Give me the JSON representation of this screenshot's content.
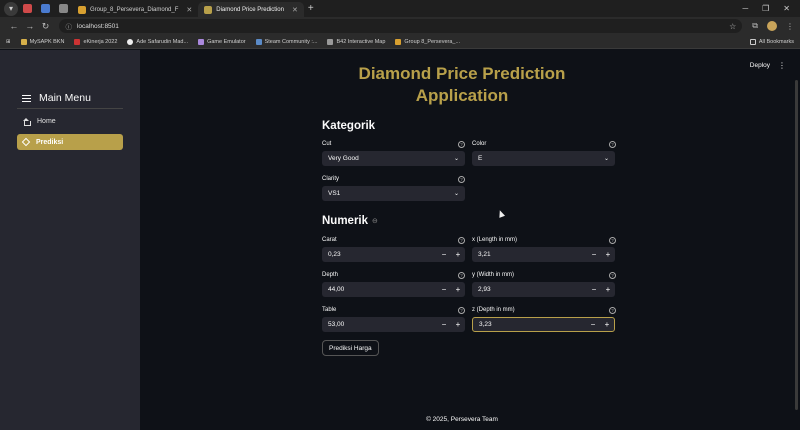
{
  "browser": {
    "tabs": [
      {
        "label": "Group_8_Persevera_Diamond_F",
        "active": false
      },
      {
        "label": "Diamond Price Prediction",
        "active": true
      }
    ],
    "url": "localhost:8501",
    "bookmarks": [
      "MySAPK BKN",
      "eKinerja 2022",
      "Ade Safarudin Mad...",
      "Game Emulator",
      "Steam Community :...",
      "B42 Interactive Map",
      "Group 8_Persevera_..."
    ],
    "all_bookmarks": "All Bookmarks"
  },
  "sidebar": {
    "title": "Main Menu",
    "items": [
      {
        "label": "Home",
        "active": false
      },
      {
        "label": "Prediksi",
        "active": true
      }
    ]
  },
  "header": {
    "deploy_label": "Deploy",
    "menu_icon": "kebab-icon"
  },
  "main": {
    "title_line1": "Diamond Price Prediction",
    "title_line2": "Application",
    "kategorik": {
      "heading": "Kategorik",
      "cut": {
        "label": "Cut",
        "value": "Very Good"
      },
      "color": {
        "label": "Color",
        "value": "E"
      },
      "clarity": {
        "label": "Clarity",
        "value": "VS1"
      }
    },
    "numerik": {
      "heading": "Numerik",
      "carat": {
        "label": "Carat",
        "value": "0,23"
      },
      "x": {
        "label": "x (Length in mm)",
        "value": "3,21"
      },
      "depth": {
        "label": "Depth",
        "value": "44,00"
      },
      "y": {
        "label": "y (Width in mm)",
        "value": "2,93"
      },
      "table": {
        "label": "Table",
        "value": "53,00"
      },
      "z": {
        "label": "z (Depth in mm)",
        "value": "3,23"
      }
    },
    "predict_button": "Prediksi Harga",
    "footer": "© 2025, Persevera Team"
  },
  "colors": {
    "accent": "#b8a04a",
    "sidebar_bg": "#262730",
    "main_bg": "#0e1117"
  }
}
